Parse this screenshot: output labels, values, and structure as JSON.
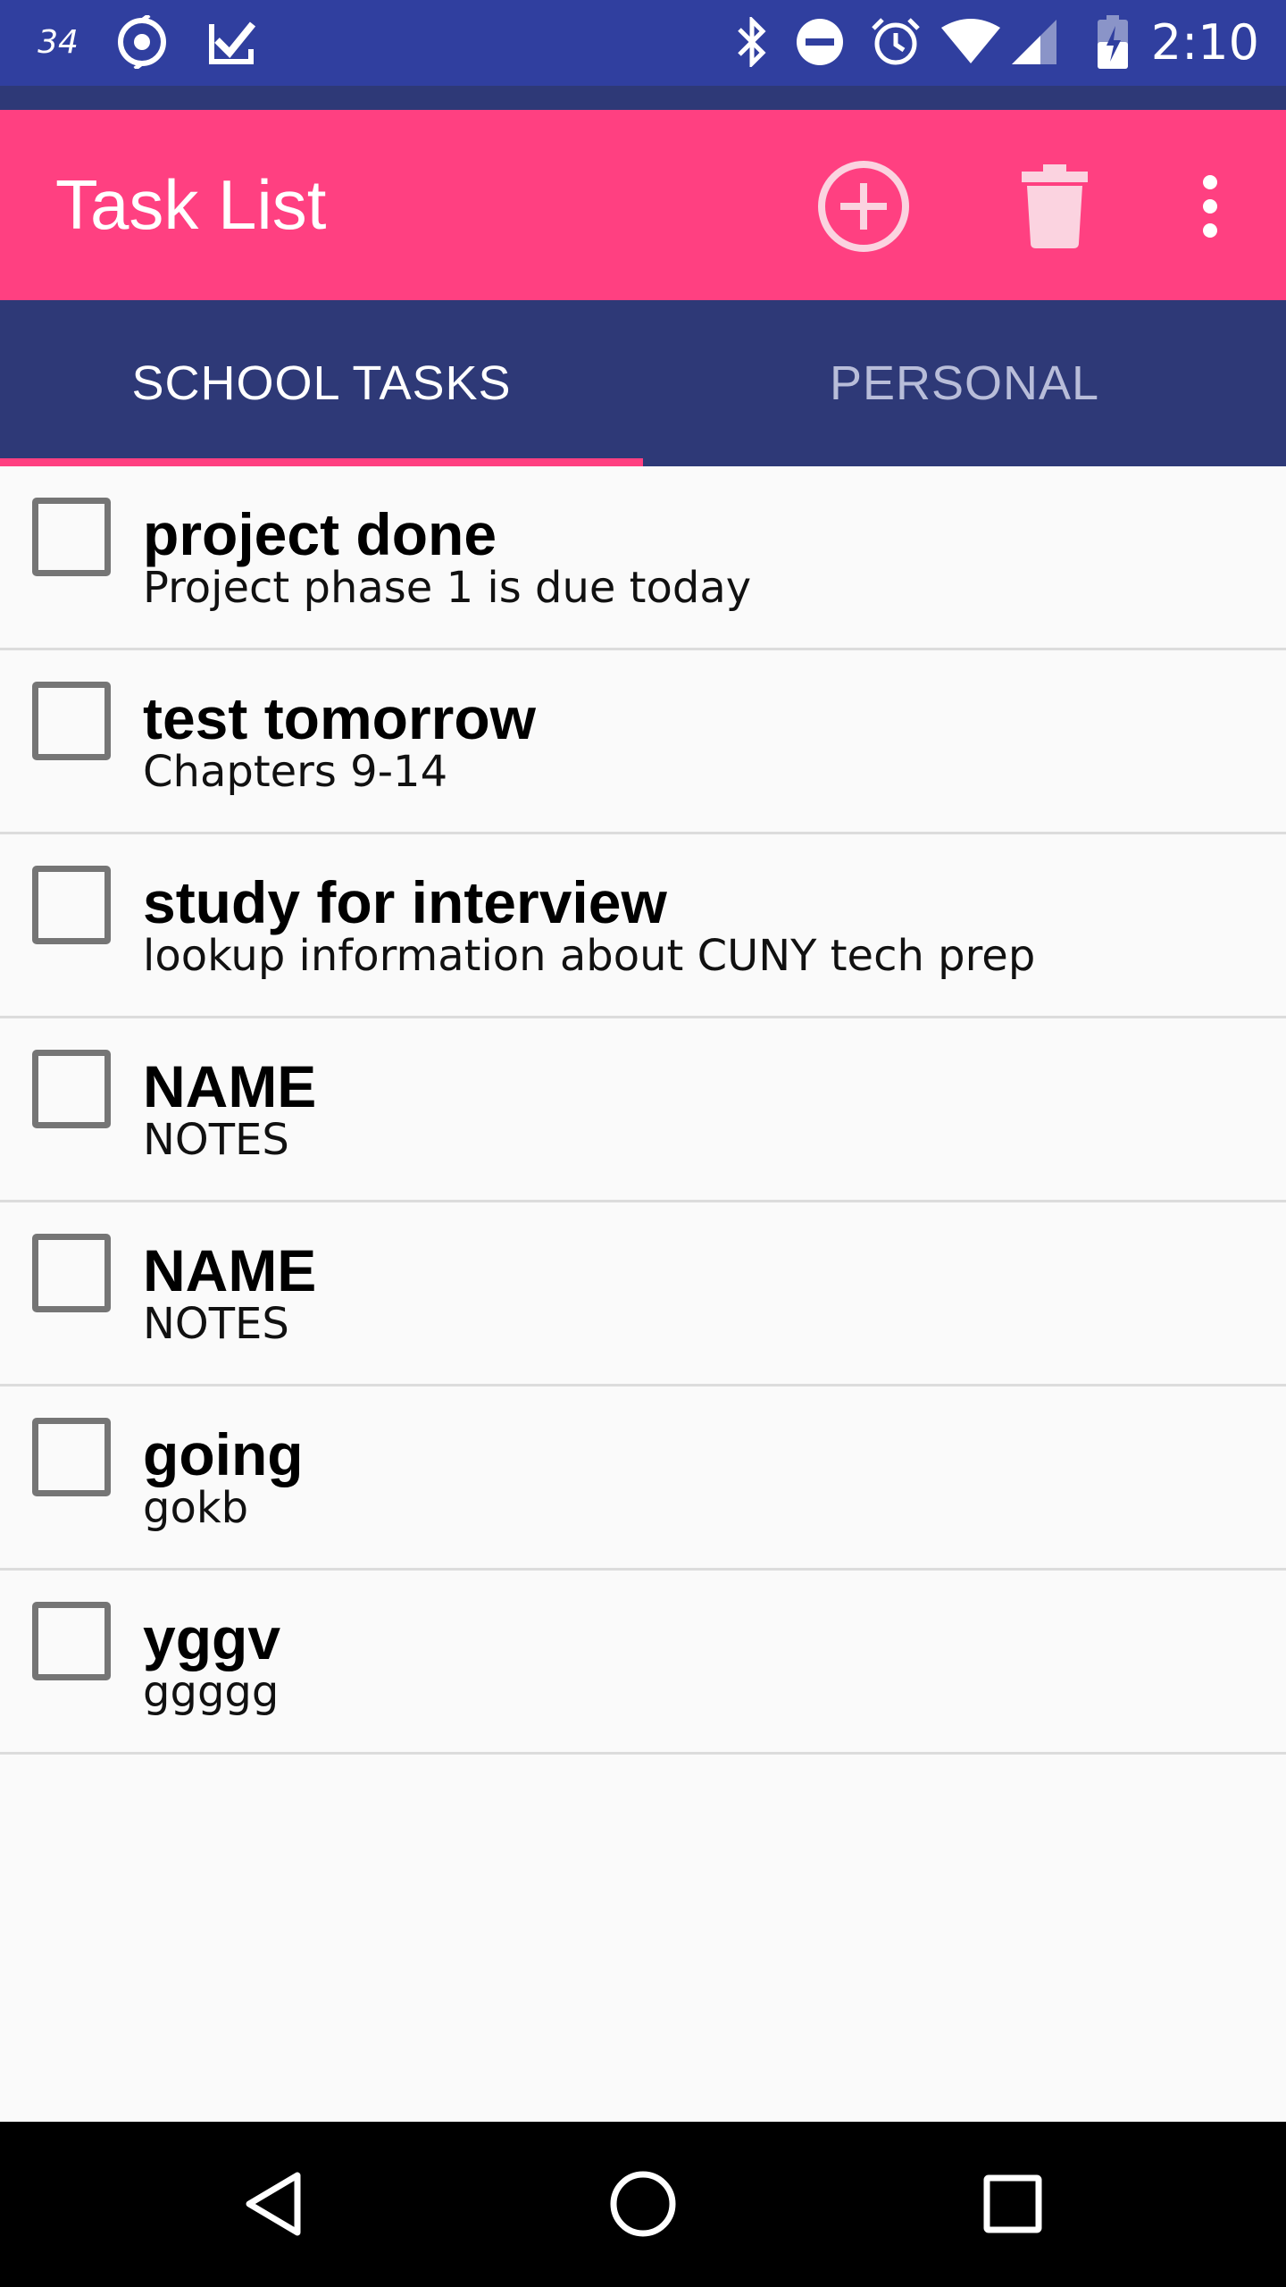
{
  "status_bar": {
    "badge_text": "34",
    "time": "2:10",
    "left_icons": [
      "notification-badge-icon",
      "sync-icon",
      "check-app-icon"
    ],
    "right_icons": [
      "bluetooth-icon",
      "do-not-disturb-icon",
      "alarm-icon",
      "wifi-icon",
      "cell-signal-icon",
      "battery-charging-icon"
    ]
  },
  "toolbar": {
    "title": "Task List",
    "actions": [
      "add-circle-icon",
      "trash-icon",
      "more-vert-icon"
    ]
  },
  "tabs": [
    {
      "label": "SCHOOL TASKS",
      "selected": true
    },
    {
      "label": "PERSONAL",
      "selected": false
    }
  ],
  "tasks": [
    {
      "name": "project done",
      "notes": "Project phase 1 is due today",
      "checked": false
    },
    {
      "name": "test tomorrow",
      "notes": "Chapters 9-14",
      "checked": false
    },
    {
      "name": "study for interview",
      "notes": "lookup information about CUNY tech prep",
      "checked": false
    },
    {
      "name": "NAME",
      "notes": "NOTES",
      "checked": false
    },
    {
      "name": "NAME",
      "notes": "NOTES",
      "checked": false
    },
    {
      "name": "going",
      "notes": "gokb",
      "checked": false
    },
    {
      "name": "yggv",
      "notes": "ggggg",
      "checked": false
    }
  ],
  "nav_bar": {
    "buttons": [
      "back-icon",
      "home-icon",
      "recents-icon"
    ]
  },
  "colors": {
    "status_bar": "#303f9f",
    "primary_dark": "#2e3977",
    "accent": "#ff4081",
    "background": "#fafafa"
  }
}
